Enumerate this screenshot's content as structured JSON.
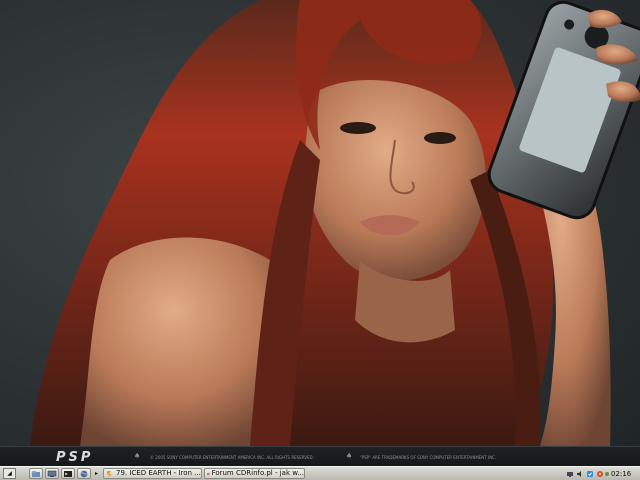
{
  "wallpaper": {
    "logo_text": "PSP",
    "legal_left": "© 2005 SONY COMPUTER ENTERTAINMENT AMERICA INC. ALL RIGHTS RESERVED.",
    "legal_right": "\"PSP\" ARE TRADEMARKS OF SONY COMPUTER ENTERTAINMENT INC.",
    "colors": {
      "background": "#2c3234",
      "hair": "#a8321e",
      "skin": "#c98a68"
    }
  },
  "taskbar": {
    "windows": [
      {
        "title": "79. ICED EARTH - Iron ..."
      },
      {
        "title": "Forum CDRinfo.pl - jak w..."
      }
    ],
    "clock": "02:16",
    "colors": {
      "bar": "#c8c7c0"
    }
  }
}
